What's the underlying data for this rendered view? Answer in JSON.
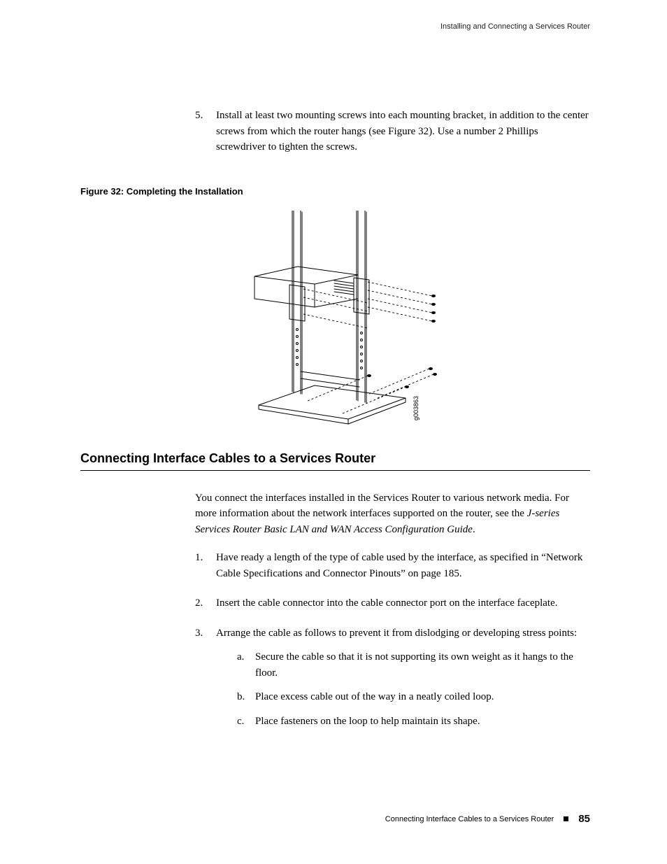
{
  "runningHeader": "Installing and Connecting a Services Router",
  "step5": {
    "num": "5.",
    "text": "Install at least two mounting screws into each mounting bracket, in addition to the center screws from which the router hangs (see Figure 32). Use a number 2 Phillips screwdriver to tighten the screws."
  },
  "figureCaption": "Figure 32: Completing the Installation",
  "figureId": "g003863",
  "sectionHeading": "Connecting Interface Cables to a Services Router",
  "intro": {
    "prefix": "You connect the interfaces installed in the Services Router to various network media. For more information about the network interfaces supported on the router, see the ",
    "italic": "J-series Services Router Basic LAN and WAN Access Configuration Guide",
    "suffix": "."
  },
  "steps": [
    {
      "num": "1.",
      "text": "Have ready a length of the type of cable used by the interface, as specified in “Network Cable Specifications and Connector Pinouts” on page 185."
    },
    {
      "num": "2.",
      "text": "Insert the cable connector into the cable connector port on the interface faceplate."
    },
    {
      "num": "3.",
      "text": "Arrange the cable as follows to prevent it from dislodging or developing stress points:",
      "subs": [
        {
          "marker": "a.",
          "text": "Secure the cable so that it is not supporting its own weight as it hangs to the floor."
        },
        {
          "marker": "b.",
          "text": "Place excess cable out of the way in a neatly coiled loop."
        },
        {
          "marker": "c.",
          "text": "Place fasteners on the loop to help maintain its shape."
        }
      ]
    }
  ],
  "footer": {
    "text": "Connecting Interface Cables to a Services Router",
    "page": "85"
  }
}
